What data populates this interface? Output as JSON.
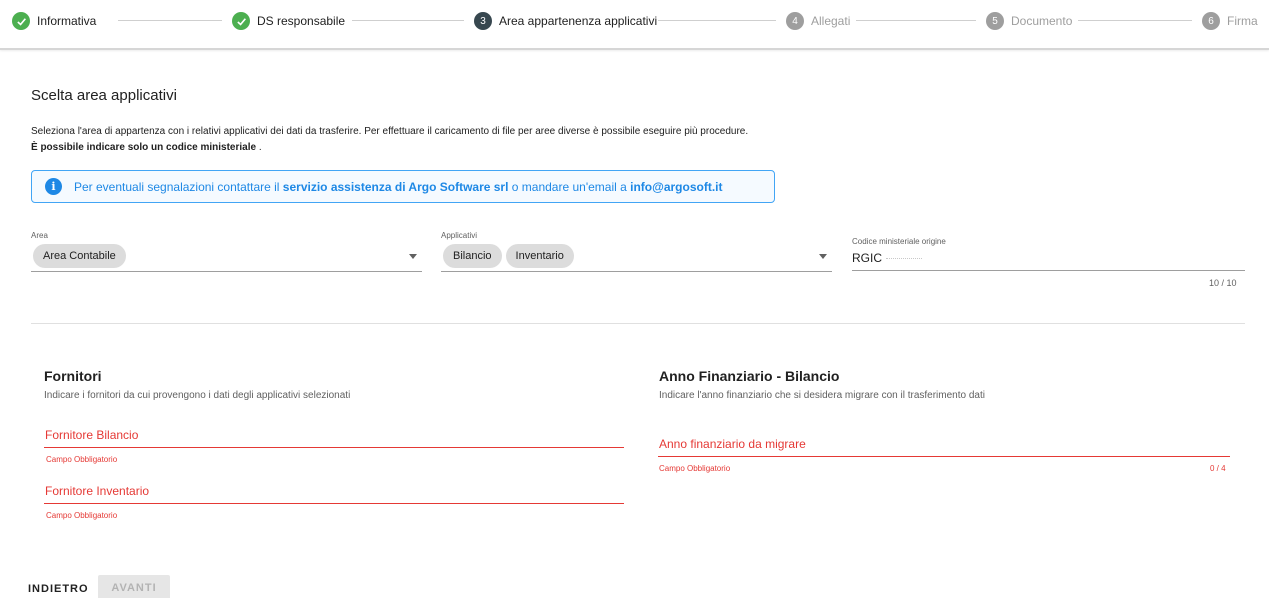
{
  "stepper": {
    "steps": [
      {
        "label": "Informativa",
        "number": "",
        "state": "done"
      },
      {
        "label": "DS responsabile",
        "number": "",
        "state": "done"
      },
      {
        "label": "Area appartenenza applicativi",
        "number": "3",
        "state": "active"
      },
      {
        "label": "Allegati",
        "number": "4",
        "state": "todo"
      },
      {
        "label": "Documento",
        "number": "5",
        "state": "todo"
      },
      {
        "label": "Firma",
        "number": "6",
        "state": "todo"
      }
    ]
  },
  "page": {
    "title": "Scelta area applicativi",
    "description": "Seleziona l'area di appartenza con i relativi applicativi dei dati da trasferire. Per effettuare il caricamento di file per aree diverse è possibile eseguire più procedure.",
    "note_bold": "È possibile indicare solo un codice ministeriale",
    "note_end": " ."
  },
  "alert": {
    "text_start": "Per eventuali segnalazioni contattare il ",
    "link_support": "servizio assistenza di Argo Software srl",
    "text_mid": " o mandare un'email a ",
    "email": "info@argosoft.it"
  },
  "form": {
    "area": {
      "label": "Area",
      "chips": [
        "Area Contabile"
      ]
    },
    "applicativi": {
      "label": "Applicativi",
      "chips": [
        "Bilancio",
        "Inventario"
      ]
    },
    "codice": {
      "label": "Codice ministeriale origine",
      "value": "RGIC",
      "counter": "10 / 10"
    }
  },
  "fornitori": {
    "title": "Fornitori",
    "description": "Indicare i fornitori da cui provengono i dati degli applicativi selezionati",
    "fields": [
      {
        "placeholder": "Fornitore Bilancio",
        "error": "Campo Obbligatorio"
      },
      {
        "placeholder": "Fornitore Inventario",
        "error": "Campo Obbligatorio"
      }
    ]
  },
  "anno": {
    "title": "Anno Finanziario - Bilancio",
    "description": "Indicare l'anno finanziario che si desidera migrare con il trasferimento dati",
    "placeholder": "Anno finanziario da migrare",
    "error": "Campo Obbligatorio",
    "counter": "0 / 4"
  },
  "footer": {
    "back_label": "INDIETRO",
    "next_label": "AVANTI"
  },
  "colors": {
    "done": "#4caf50",
    "active": "#37474f",
    "todo": "#9e9e9e",
    "info": "#1e88e5",
    "error": "#e53935"
  },
  "icons": {
    "done_step": "check-icon",
    "alert": "info-icon",
    "select": "caret-down-icon"
  }
}
